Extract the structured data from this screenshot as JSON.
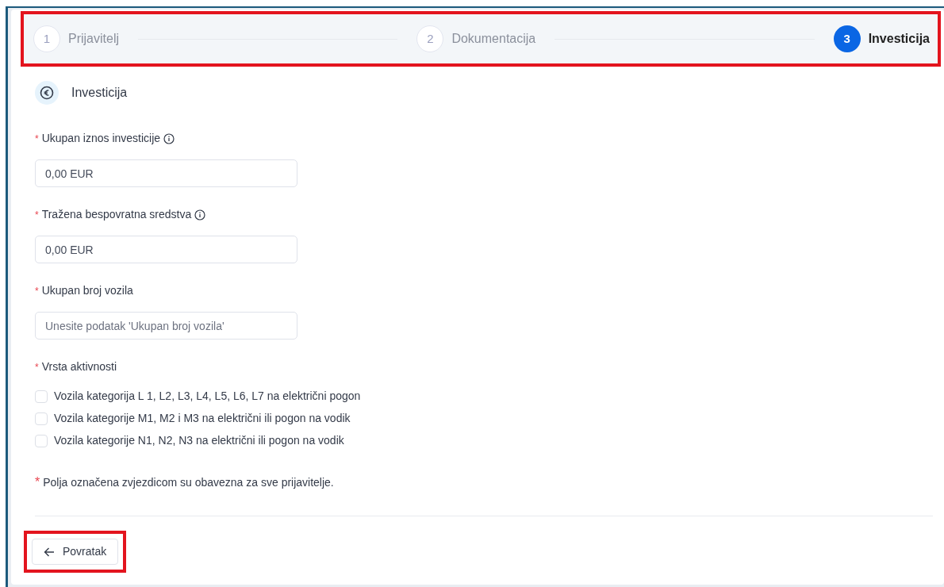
{
  "stepper": {
    "highlighted": true,
    "steps": [
      {
        "number": "1",
        "label": "Prijavitelj",
        "selected": false
      },
      {
        "number": "2",
        "label": "Dokumentacija",
        "selected": false
      },
      {
        "number": "3",
        "label": "Investicija",
        "selected": true
      }
    ]
  },
  "section": {
    "title": "Investicija"
  },
  "fields": [
    {
      "kind": "input",
      "label": "Ukupan iznos investicije",
      "required": true,
      "info": true,
      "value": "0,00 EUR"
    },
    {
      "kind": "input",
      "label": "Tražena bespovratna sredstva",
      "required": true,
      "info": true,
      "value": "0,00 EUR"
    },
    {
      "kind": "input",
      "label": "Ukupan broj vozila",
      "required": true,
      "info": false,
      "placeholder": "Unesite podatak 'Ukupan broj vozila'"
    },
    {
      "kind": "checkboxes",
      "label": "Vrsta aktivnosti",
      "required": true,
      "info": false,
      "options": [
        {
          "label": "Vozila kategorija L 1, L2, L3, L4, L5, L6, L7 na električni pogon",
          "checked": false
        },
        {
          "label": "Vozila kategorije M1, M2 i M3 na električni ili pogon na vodik",
          "checked": false
        },
        {
          "label": "Vozila kategorije N1, N2, N3 na električni ili pogon na vodik",
          "checked": false
        }
      ]
    }
  ],
  "note": {
    "marker": "*",
    "text": "Polja označena zvjezdicom su obavezna za sve prijavitelje."
  },
  "back_button": {
    "label": "Povratak",
    "highlighted": true
  }
}
